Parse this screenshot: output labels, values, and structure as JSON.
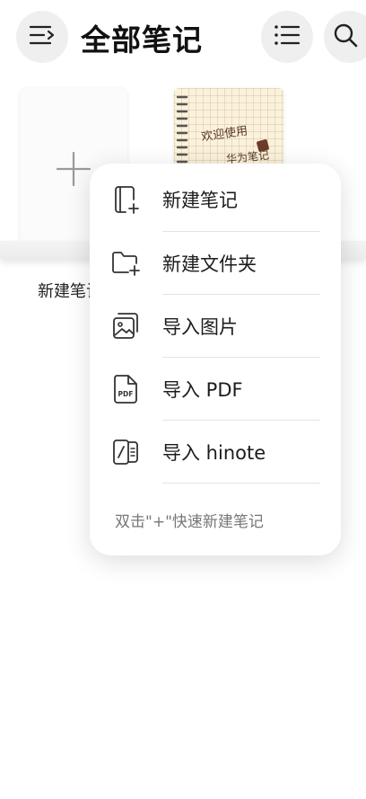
{
  "header": {
    "title": "全部笔记",
    "menu_icon": "menu-icon",
    "list_icon": "list-view-icon",
    "search_icon": "search-icon"
  },
  "shelf": {
    "new_note_label": "新建笔记",
    "notebook_cover_text_1": "欢迎使用",
    "notebook_cover_text_2": "华为笔记"
  },
  "popup": {
    "items": [
      {
        "label": "新建笔记",
        "icon": "new-note-icon"
      },
      {
        "label": "新建文件夹",
        "icon": "new-folder-icon"
      },
      {
        "label": "导入图片",
        "icon": "image-icon"
      },
      {
        "label": "导入 PDF",
        "icon": "pdf-icon"
      },
      {
        "label": "导入 hinote",
        "icon": "hinote-icon"
      }
    ],
    "hint": "双击\"+\"快速新建笔记"
  },
  "colors": {
    "accent_bg": "#efefef",
    "popup_bg": "#ffffff",
    "notebook_bg": "#fbf2dc"
  }
}
